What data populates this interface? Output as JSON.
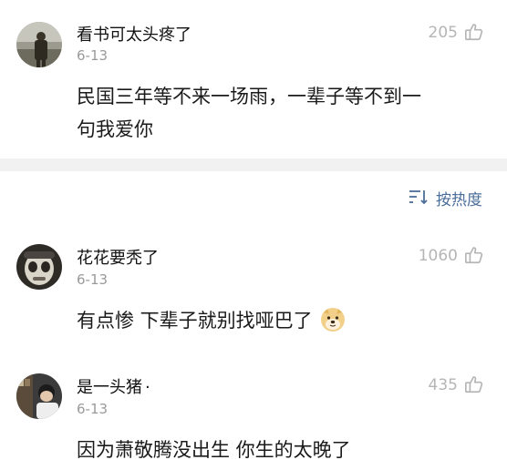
{
  "comments_top": {
    "username": "看书可太头疼了",
    "date": "6-13",
    "likes": "205",
    "content_line1": "民国三年等不来一场雨，一辈子等不到一",
    "content_line2": "句我爱你"
  },
  "sort_control": {
    "label": "按热度"
  },
  "comments": [
    {
      "username": "花花要秃了",
      "date": "6-13",
      "likes": "1060",
      "content": "有点惨 下辈子就别找哑巴了",
      "emoji": "doge-emoji"
    },
    {
      "username": "是一头猪",
      "username_suffix": "·",
      "date": "6-13",
      "likes": "435",
      "content": "因为萧敬腾没出生 你生的太晚了"
    }
  ],
  "icons": {
    "like": "thumbs-up-icon",
    "sort": "sort-icon"
  }
}
